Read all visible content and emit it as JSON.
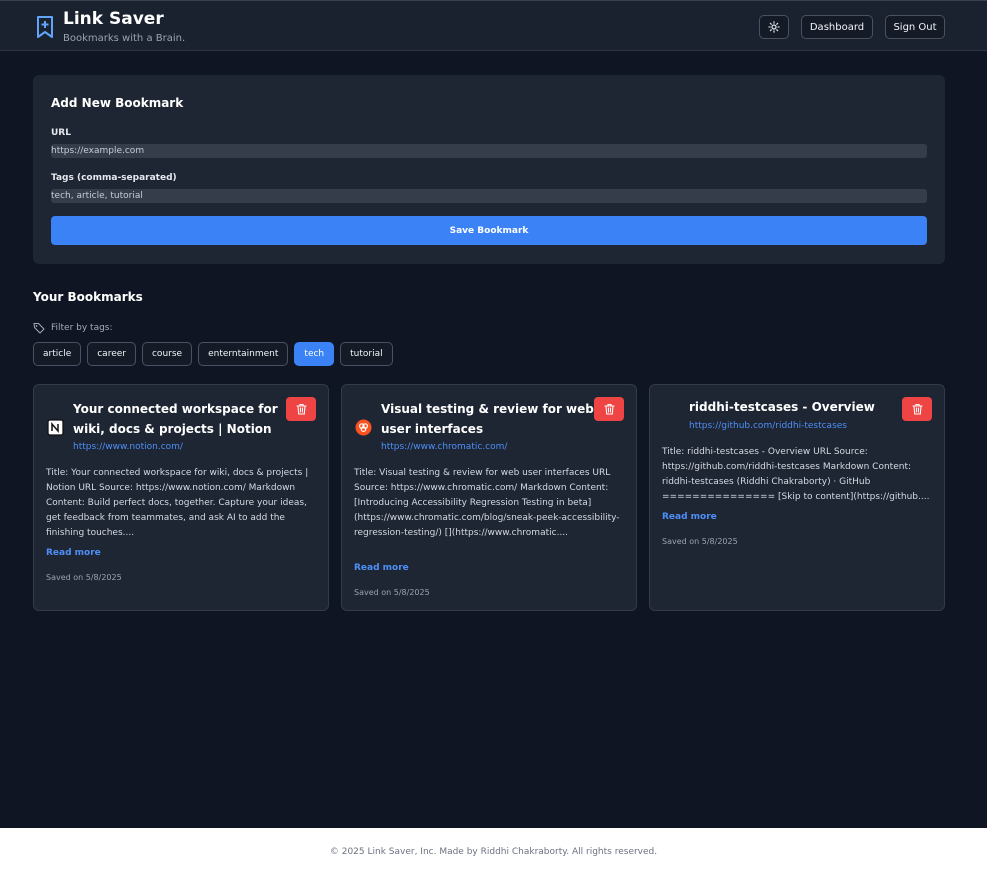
{
  "header": {
    "title": "Link Saver",
    "subtitle": "Bookmarks with a Brain.",
    "theme_icon": "sun-icon",
    "dashboard_label": "Dashboard",
    "signout_label": "Sign Out"
  },
  "form": {
    "title": "Add New Bookmark",
    "url_label": "URL",
    "url_placeholder": "https://example.com",
    "tags_label": "Tags (comma-separated)",
    "tags_placeholder": "tech, article, tutorial",
    "save_label": "Save Bookmark"
  },
  "bookmarks_section": {
    "title": "Your Bookmarks",
    "filter_label": "Filter by tags:",
    "tags": [
      {
        "label": "article",
        "active": false
      },
      {
        "label": "career",
        "active": false
      },
      {
        "label": "course",
        "active": false
      },
      {
        "label": "enterntainment",
        "active": false
      },
      {
        "label": "tech",
        "active": true
      },
      {
        "label": "tutorial",
        "active": false
      }
    ]
  },
  "bookmarks": [
    {
      "title": "Your connected workspace for wiki, docs & projects | Notion",
      "url": "https://www.notion.com/",
      "favicon": "notion-icon",
      "description": "Title: Your connected workspace for wiki, docs & projects | Notion URL Source: https://www.notion.com/ Markdown Content: Build perfect docs, together. Capture your ideas, get feedback from teammates, and ask AI to add the finishing touches....",
      "read_more": "Read more",
      "saved": "Saved on 5/8/2025"
    },
    {
      "title": "Visual testing & review for web user interfaces",
      "url": "https://www.chromatic.com/",
      "favicon": "chromatic-icon",
      "description": "Title: Visual testing & review for web user interfaces URL Source: https://www.chromatic.com/ Markdown Content: [Introducing Accessibility Regression Testing in beta](https://www.chromatic.com/blog/sneak-peek-accessibility-regression-testing/) [](https://www.chromatic....",
      "read_more": "Read more",
      "saved": "Saved on 5/8/2025"
    },
    {
      "title": "riddhi-testcases - Overview",
      "url": "https://github.com/riddhi-testcases",
      "favicon": "",
      "description": "Title: riddhi-testcases - Overview URL Source: https://github.com/riddhi-testcases Markdown Content: riddhi-testcases (Riddhi Chakraborty) · GitHub =============== [Skip to content](https://github....",
      "read_more": "Read more",
      "saved": "Saved on 5/8/2025"
    }
  ],
  "footer": {
    "text": "© 2025 Link Saver, Inc. Made by Riddhi Chakraborty. All rights reserved."
  },
  "colors": {
    "background": "#0f1522",
    "card": "#1e2533",
    "accent": "#3b82f6",
    "danger": "#ef4444"
  }
}
